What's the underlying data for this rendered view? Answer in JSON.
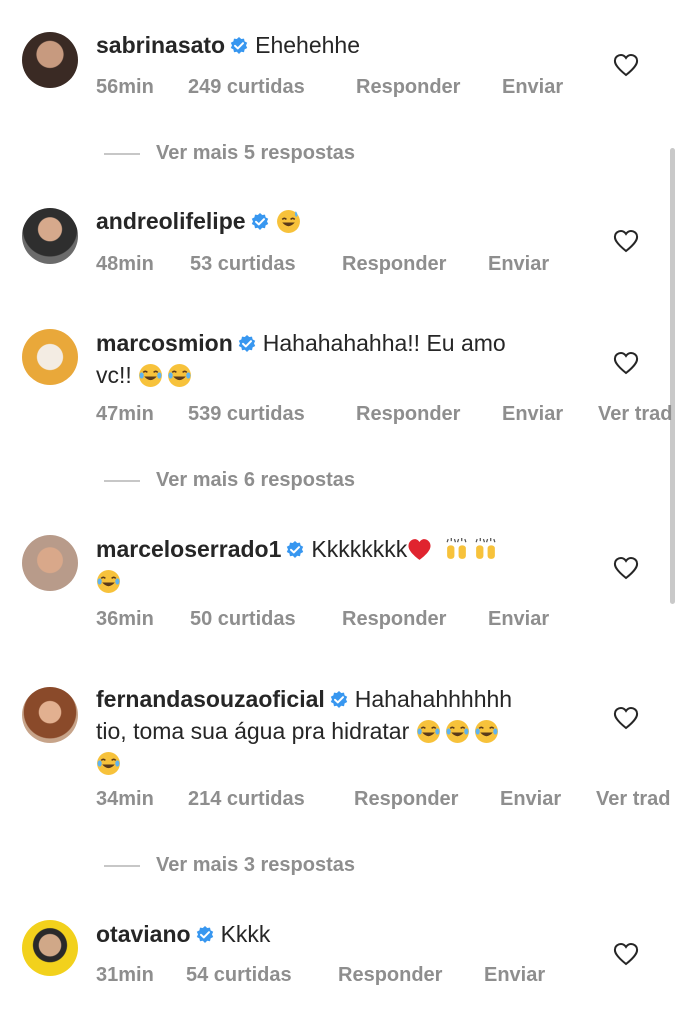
{
  "comments": [
    {
      "username": "sabrinasato",
      "text": "Ehehehhe",
      "time": "56min",
      "likes": "249 curtidas",
      "reply": "Responder",
      "send": "Enviar",
      "emojis": [],
      "avatar_color": "#3a2a24"
    },
    {
      "username": "andreolifelipe",
      "text": "",
      "time": "48min",
      "likes": "53 curtidas",
      "reply": "Responder",
      "send": "Enviar",
      "emojis": [
        "grinning-sweat-emoji"
      ],
      "avatar_color": "#4a4a4a"
    },
    {
      "username": "marcosmion",
      "text": "Hahahahahha!! Eu amo",
      "text_line2": "vc!!",
      "time": "47min",
      "likes": "539 curtidas",
      "reply": "Responder",
      "send": "Enviar",
      "translate": "Ver trad",
      "emojis": [
        "tears-of-joy-emoji",
        "tears-of-joy-emoji"
      ],
      "avatar_color": "#e9a83a"
    },
    {
      "username": "marceloserrado1",
      "text": "Kkkkkkkk",
      "time": "36min",
      "likes": "50 curtidas",
      "reply": "Responder",
      "send": "Enviar",
      "emojis": [
        "red-heart-emoji",
        "raising-hands-emoji",
        "raising-hands-emoji",
        "tears-of-joy-emoji"
      ],
      "avatar_color": "#b89b8a"
    },
    {
      "username": "fernandasouzaoficial",
      "text": "Hahahahhhhhh",
      "text_line2": "tio, toma sua água pra hidratar",
      "time": "34min",
      "likes": "214 curtidas",
      "reply": "Responder",
      "send": "Enviar",
      "translate": "Ver trad",
      "emojis": [
        "tears-of-joy-emoji",
        "tears-of-joy-emoji",
        "tears-of-joy-emoji",
        "tears-of-joy-emoji"
      ],
      "avatar_color": "#8a4a2a"
    },
    {
      "username": "otaviano",
      "text": "Kkkk",
      "time": "31min",
      "likes": "54 curtidas",
      "reply": "Responder",
      "send": "Enviar",
      "emojis": [],
      "avatar_color": "#f2d11c"
    }
  ],
  "more_replies": [
    "Ver mais 5 respostas",
    "Ver mais 6 respostas",
    "Ver mais 3 respostas"
  ],
  "colors": {
    "text": "#262626",
    "muted": "#8e8e8e",
    "verified": "#3897f0",
    "heart_outline": "#262626"
  }
}
